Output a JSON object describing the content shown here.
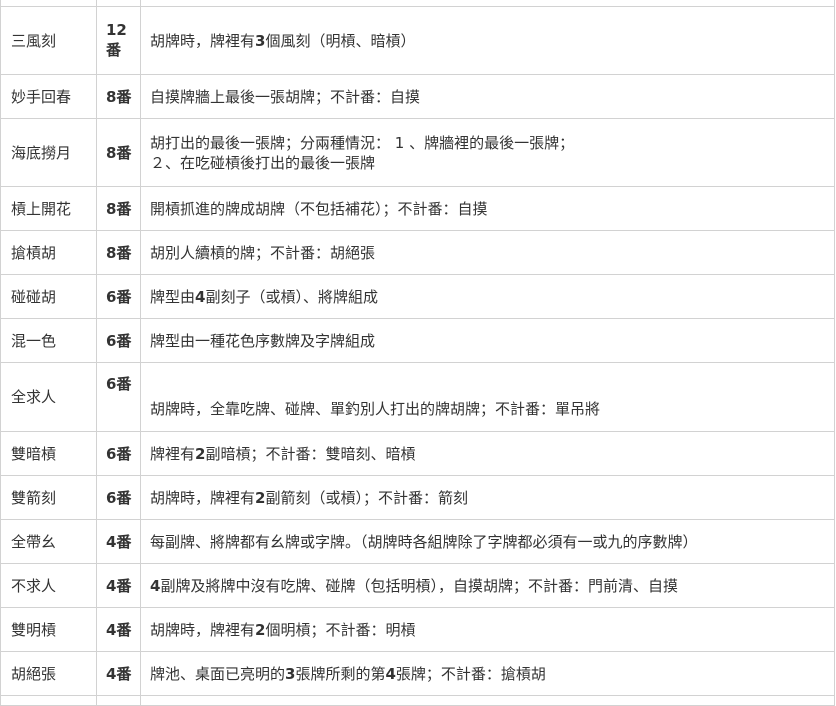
{
  "rows": [
    {
      "name": "三風刻",
      "fan": "12番",
      "desc": [
        [
          "胡牌時，牌裡有",
          false
        ],
        [
          "3",
          true
        ],
        [
          "個風刻（明槓、暗槓）",
          false
        ]
      ]
    },
    {
      "name": "妙手回春",
      "fan": "8番",
      "desc": [
        [
          "自摸牌牆上最後一張胡牌；不計番：自摸",
          false
        ]
      ]
    },
    {
      "name": "海底撈月",
      "fan": "8番",
      "desc": [
        [
          "胡打出的最後一張牌；分兩種情況： 1 、牌牆裡的最後一張牌；",
          false
        ]
      ],
      "desc2": "２、在吃碰槓後打出的最後一張牌"
    },
    {
      "name": "槓上開花",
      "fan": "8番",
      "desc": [
        [
          "開槓抓進的牌成胡牌（不包括補花）；不計番：自摸",
          false
        ]
      ]
    },
    {
      "name": "搶槓胡",
      "fan": "8番",
      "desc": [
        [
          "胡別人續槓的牌；不計番：胡絕張",
          false
        ]
      ]
    },
    {
      "name": "碰碰胡",
      "fan": "6番",
      "desc": [
        [
          "牌型由",
          false
        ],
        [
          "4",
          true
        ],
        [
          "副刻子（或槓）、將牌組成",
          false
        ]
      ]
    },
    {
      "name": "混一色",
      "fan": "6番",
      "desc": [
        [
          "牌型由一種花色序數牌及字牌組成",
          false
        ]
      ]
    },
    {
      "name": "全求人",
      "fan": "6番",
      "desc": [
        [
          "胡牌時，全靠吃牌、碰牌、單釣別人打出的牌胡牌；不計番：單吊將",
          false
        ]
      ]
    },
    {
      "name": "雙暗槓",
      "fan": "6番",
      "desc": [
        [
          "牌裡有",
          false
        ],
        [
          "2",
          true
        ],
        [
          "副暗槓；不計番：雙暗刻、暗槓",
          false
        ]
      ]
    },
    {
      "name": "雙箭刻",
      "fan": "6番",
      "desc": [
        [
          "胡牌時，牌裡有",
          false
        ],
        [
          "2",
          true
        ],
        [
          "副箭刻（或槓）；不計番：箭刻",
          false
        ]
      ]
    },
    {
      "name": "全帶幺",
      "fan": "4番",
      "desc": [
        [
          "每副牌、將牌都有幺牌或字牌。（胡牌時各組牌除了字牌都必須有一或九的序數牌）",
          false
        ]
      ]
    },
    {
      "name": "不求人",
      "fan": "4番",
      "desc": [
        [
          "4",
          true
        ],
        [
          "副牌及將牌中沒有吃牌、碰牌（包括明槓），自摸胡牌；不計番：門前清、自摸",
          false
        ]
      ]
    },
    {
      "name": "雙明槓",
      "fan": "4番",
      "desc": [
        [
          "胡牌時，牌裡有",
          false
        ],
        [
          "2",
          true
        ],
        [
          "個明槓；不計番：明槓",
          false
        ]
      ]
    },
    {
      "name": "胡絕張",
      "fan": "4番",
      "desc": [
        [
          "牌池、桌面已亮明的",
          false
        ],
        [
          "3",
          true
        ],
        [
          "張牌所剩的第",
          false
        ],
        [
          "4",
          true
        ],
        [
          "張牌；不計番：搶槓胡",
          false
        ]
      ]
    }
  ]
}
